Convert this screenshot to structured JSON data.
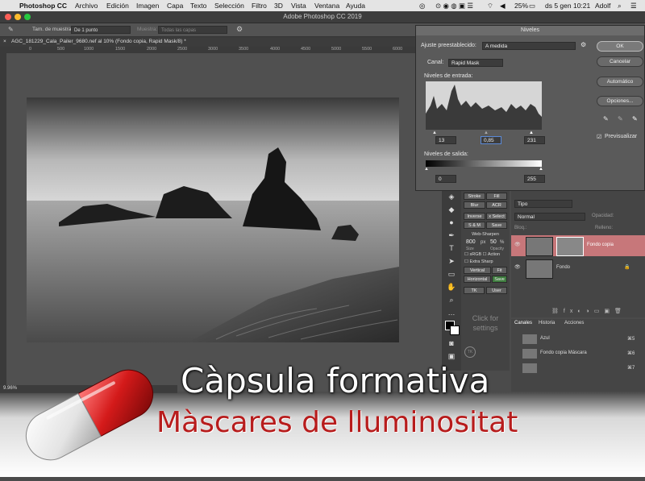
{
  "menubar": {
    "items": [
      "Photoshop CC",
      "Archivo",
      "Edición",
      "Imagen",
      "Capa",
      "Texto",
      "Selección",
      "Filtro",
      "3D",
      "Vista",
      "Ventana",
      "Ayuda"
    ],
    "battery": "25%",
    "datetime": "ds 5 gen  10:21",
    "user": "Adolf"
  },
  "window": {
    "title": "Adobe Photoshop CC 2019"
  },
  "options": {
    "sample_size_label": "Tam. de muestra:",
    "sample_size_value": "De 1 punto",
    "sample_label": "Muestra:",
    "sample_value": "Todas las capas"
  },
  "document": {
    "tab": "AGC_181229_Cala_Pailer_9680.nef al 10% (Fondo copia, Rapid Mask/8) *",
    "zoom": "9.96%",
    "ruler_ticks": [
      "0",
      "500",
      "1000",
      "1500",
      "2000",
      "2500",
      "3000",
      "3500",
      "4000",
      "4500",
      "5000",
      "5500",
      "6000"
    ]
  },
  "levels": {
    "title": "Niveles",
    "preset_label": "Ajuste preestablecido:",
    "preset_value": "A medida",
    "channel_label": "Canal:",
    "channel_value": "Rapid Mask",
    "input_label": "Niveles de entrada:",
    "input_black": "13",
    "input_gamma": "0,85",
    "input_white": "231",
    "output_label": "Niveles de salida:",
    "output_black": "0",
    "output_white": "255",
    "ok": "OK",
    "cancel": "Cancelar",
    "auto": "Automático",
    "options": "Opciones...",
    "preview": "Previsualizar"
  },
  "script_panel": {
    "buttons": [
      "Stroke",
      "Fill",
      "Blur",
      "ACR",
      "Inverse",
      "x Select",
      "S & M",
      "Save"
    ],
    "web_sharpen": "Web-Sharpen",
    "size_value": "800",
    "size_unit": "px",
    "opacity_value": "50",
    "opacity_unit": "%",
    "size_label": "Size",
    "opacity_label": "Opacity",
    "srgb": "sRGB",
    "action": "Action",
    "extra_sharp": "Extra Sharp",
    "vertical": "Vertical",
    "fit": "Fit",
    "horizontal": "Horizontal",
    "save2": "Save",
    "tk": "TK",
    "user": "User",
    "click_for": "Click for",
    "settings": "settings"
  },
  "layers": {
    "filter": "Tipo",
    "blend": "Normal",
    "opacity_label": "Opacidad:",
    "fill_label": "Relleno:",
    "lock_label": "Bloq.:",
    "rows": [
      "Fondo copia",
      "Fondo"
    ]
  },
  "channels": {
    "tabs": [
      "Canales",
      "Historia",
      "Acciones"
    ],
    "rows": [
      {
        "name": "Azul",
        "shortcut": "⌘5"
      },
      {
        "name": "Fondo copia Máscara",
        "shortcut": "⌘6"
      },
      {
        "name": "",
        "shortcut": "⌘7"
      }
    ]
  },
  "overlay": {
    "line1": "Càpsula formativa",
    "line2": "Màscares de lluminositat"
  }
}
